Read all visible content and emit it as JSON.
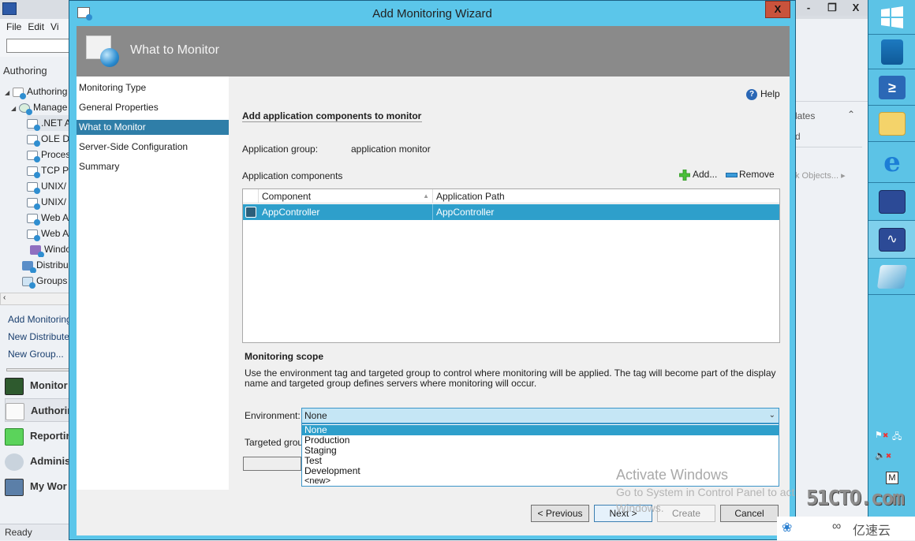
{
  "background_app": {
    "menu": [
      "File",
      "Edit",
      "Vi"
    ],
    "pane_title": "Authoring",
    "tree": [
      {
        "label": "Authoring",
        "level": 0,
        "expanded": true,
        "icon": "authoring-icon"
      },
      {
        "label": "Manage",
        "level": 1,
        "expanded": true,
        "icon": "monitor-icon"
      },
      {
        "label": ".NET A",
        "level": 2,
        "icon": "app-icon"
      },
      {
        "label": "OLE D",
        "level": 2,
        "icon": "template-icon"
      },
      {
        "label": "Proces",
        "level": 2,
        "icon": "template-icon"
      },
      {
        "label": "TCP Po",
        "level": 2,
        "icon": "template-icon"
      },
      {
        "label": "UNIX/",
        "level": 2,
        "icon": "template-icon"
      },
      {
        "label": "UNIX/",
        "level": 2,
        "icon": "template-icon"
      },
      {
        "label": "Web A",
        "level": 2,
        "icon": "template-icon"
      },
      {
        "label": "Web A",
        "level": 2,
        "icon": "template-icon"
      },
      {
        "label": "Windo",
        "level": 2,
        "icon": "windows-icon"
      },
      {
        "label": "Distribu",
        "level": 1,
        "icon": "distributed-icon"
      },
      {
        "label": "Groups",
        "level": 1,
        "icon": "groups-icon"
      }
    ],
    "tasks": [
      "Add Monitoring",
      "New Distributed",
      "New Group..."
    ],
    "workspaces": [
      "Monitor",
      "Authorin",
      "Reportin",
      "Adminis",
      "My Wor"
    ],
    "status": "Ready",
    "right_pane": {
      "templates": "lates",
      "item": "d",
      "objects": "k Objects..."
    },
    "window_buttons": [
      "-",
      "❐",
      "X"
    ]
  },
  "wizard": {
    "title": "Add Monitoring Wizard",
    "close": "X",
    "header_title": "What to Monitor",
    "nav": [
      {
        "label": "Monitoring Type",
        "active": false
      },
      {
        "label": "General Properties",
        "active": false
      },
      {
        "label": "What to Monitor",
        "active": true
      },
      {
        "label": "Server-Side Configuration",
        "active": false
      },
      {
        "label": "Summary",
        "active": false
      }
    ],
    "help": "Help",
    "section_title": "Add application components to monitor",
    "app_group_label": "Application group:",
    "app_group_value": "application monitor",
    "components_label": "Application components",
    "add_label": "Add...",
    "remove_label": "Remove",
    "grid": {
      "columns": [
        "Component",
        "Application Path"
      ],
      "rows": [
        {
          "component": "AppController",
          "path": "AppController",
          "selected": true
        }
      ]
    },
    "scope_title": "Monitoring scope",
    "scope_desc": "Use the environment tag and targeted group to control where monitoring will be applied. The tag will become part of the display name and targeted group defines servers where monitoring will occur.",
    "environment_label": "Environment:",
    "environment_value": "None",
    "environment_options": [
      "None",
      "Production",
      "Staging",
      "Test",
      "Development",
      "<new>"
    ],
    "targeted_group_label": "Targeted group",
    "buttons": {
      "previous": "< Previous",
      "next": "Next >",
      "create": "Create",
      "cancel": "Cancel"
    }
  },
  "watermarks": {
    "activate_title": "Activate Windows",
    "activate_line1": "Go to System in Control Panel to act",
    "activate_line2": "Windows.",
    "site": "51CTO.com",
    "yisu": "亿速云"
  },
  "tray": {
    "m_label": "M"
  }
}
